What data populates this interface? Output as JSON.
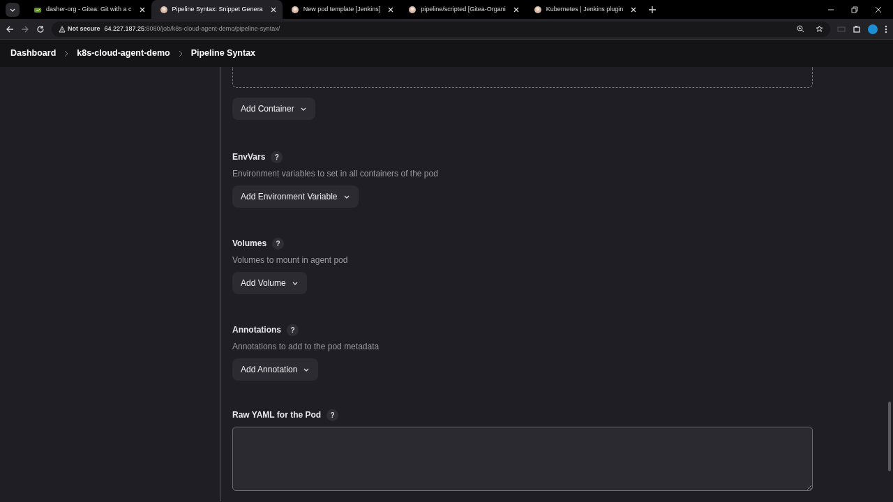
{
  "browser": {
    "tabs": [
      {
        "title": "dasher-org - Gitea: Git with a c",
        "kind": "gitea",
        "selected": false
      },
      {
        "title": "Pipeline Syntax: Snippet Genera",
        "kind": "jenkins",
        "selected": true
      },
      {
        "title": "New pod template [Jenkins]",
        "kind": "jenkins",
        "selected": false
      },
      {
        "title": "pipeline/scripted [Gitea-Organi",
        "kind": "jenkins",
        "selected": false
      },
      {
        "title": "Kubernetes | Jenkins plugin",
        "kind": "jenkins",
        "selected": false
      }
    ],
    "security": "Not secure",
    "url_host": "64.227.187.25",
    "url_rest": ":8080/job/k8s-cloud-agent-demo/pipeline-syntax/"
  },
  "breadcrumb": [
    {
      "label": "Dashboard"
    },
    {
      "label": "k8s-cloud-agent-demo"
    },
    {
      "label": "Pipeline Syntax"
    }
  ],
  "top_button": {
    "label": "Add Container"
  },
  "sections": [
    {
      "kind": "repeatable",
      "title": "EnvVars",
      "help": "?",
      "description": "Environment variables to set in all containers of the pod",
      "button": "Add Environment Variable"
    },
    {
      "kind": "repeatable",
      "title": "Volumes",
      "help": "?",
      "description": "Volumes to mount in agent pod",
      "button": "Add Volume"
    },
    {
      "kind": "repeatable",
      "title": "Annotations",
      "help": "?",
      "description": "Annotations to add to the pod metadata",
      "button": "Add Annotation"
    },
    {
      "kind": "textarea",
      "title": "Raw YAML for the Pod",
      "help": "?"
    }
  ]
}
